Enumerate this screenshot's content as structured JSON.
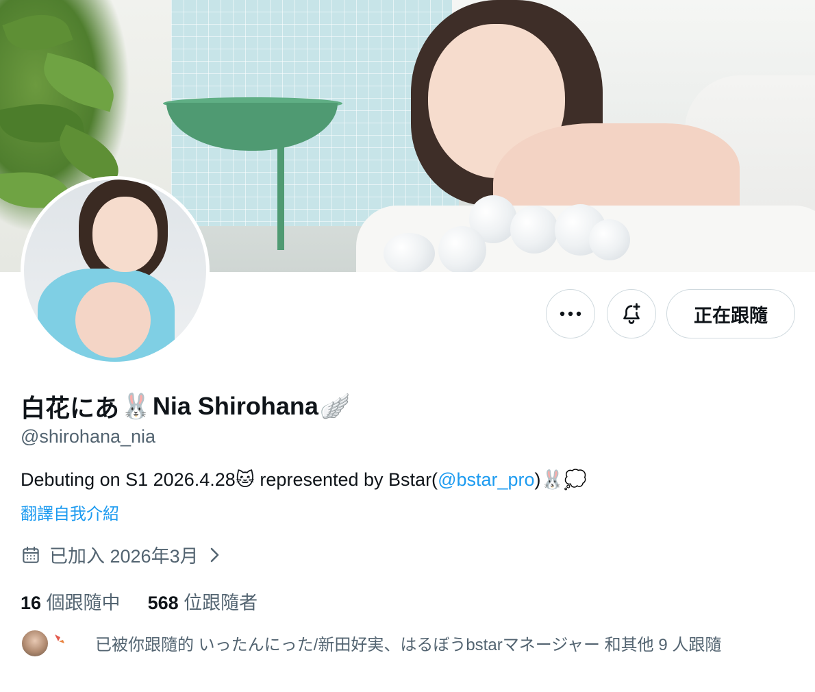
{
  "profile": {
    "display_name_jp": "白花にあ",
    "display_name_en": "Nia Shirohana",
    "handle": "@shirohana_nia",
    "bio_part1": "Debuting on S1 2026.4.28",
    "bio_part2": " represented by Bstar(",
    "bio_mention": "@bstar_pro",
    "bio_part3": ")",
    "translate_link": "翻譯自我介紹",
    "joined": "已加入 2026年3月"
  },
  "emoji": {
    "rabbit": "🐰",
    "wing": "🪽",
    "cat": "🐱",
    "bubble": "💭"
  },
  "actions": {
    "more_label": "•••",
    "follow_label": "正在跟隨"
  },
  "stats": {
    "following_count": "16",
    "following_label": "個跟隨中",
    "followers_count": "568",
    "followers_label": "位跟隨者"
  },
  "followed_by": {
    "text": "已被你跟隨的 いったんにった/新田好実、はるぼうbstarマネージャー 和其他 9 人跟隨"
  },
  "icons": [
    "more-icon",
    "bell-plus-icon",
    "calendar-icon",
    "chevron-right-icon"
  ],
  "colors": {
    "accent": "#1d9bf0",
    "text_primary": "#0f1419",
    "text_secondary": "#536471",
    "border": "#cfd9de"
  }
}
